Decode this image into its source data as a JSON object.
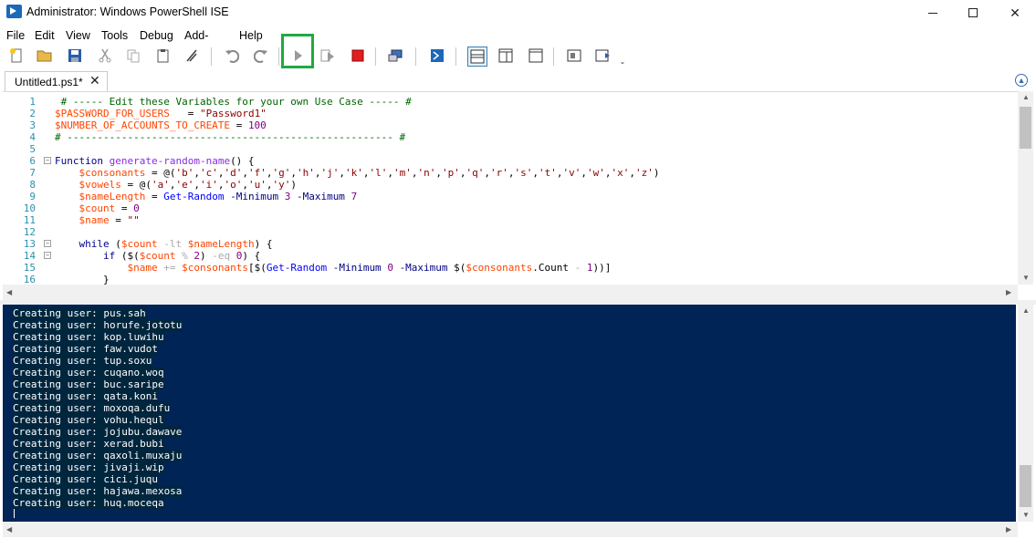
{
  "window": {
    "title": "Administrator: Windows PowerShell ISE"
  },
  "menu": [
    "File",
    "Edit",
    "View",
    "Tools",
    "Debug",
    "Add-ons",
    "Help"
  ],
  "tab": {
    "label": "Untitled1.ps1*",
    "close": "✕"
  },
  "editor": {
    "lines": [
      {
        "n": "1",
        "segs": [
          [
            "c-comment",
            " # ----- Edit these Variables for your own Use Case ----- #"
          ]
        ]
      },
      {
        "n": "2",
        "segs": [
          [
            "c-var",
            "$PASSWORD_FOR_USERS"
          ],
          [
            "c-plain",
            "   = "
          ],
          [
            "c-str",
            "\"Password1\""
          ]
        ]
      },
      {
        "n": "3",
        "segs": [
          [
            "c-var",
            "$NUMBER_OF_ACCOUNTS_TO_CREATE"
          ],
          [
            "c-plain",
            " = "
          ],
          [
            "c-num",
            "100"
          ]
        ]
      },
      {
        "n": "4",
        "segs": [
          [
            "c-comment",
            "# ------------------------------------------------------ #"
          ]
        ]
      },
      {
        "n": "5",
        "segs": []
      },
      {
        "n": "6",
        "fold": true,
        "segs": [
          [
            "c-kw",
            "Function"
          ],
          [
            "c-plain",
            " "
          ],
          [
            "c-fn",
            "generate-random-name"
          ],
          [
            "c-plain",
            "() {"
          ]
        ]
      },
      {
        "n": "7",
        "segs": [
          [
            "c-plain",
            "    "
          ],
          [
            "c-var",
            "$consonants"
          ],
          [
            "c-plain",
            " = @("
          ],
          [
            "c-str",
            "'b'"
          ],
          [
            "c-plain",
            ","
          ],
          [
            "c-str",
            "'c'"
          ],
          [
            "c-plain",
            ","
          ],
          [
            "c-str",
            "'d'"
          ],
          [
            "c-plain",
            ","
          ],
          [
            "c-str",
            "'f'"
          ],
          [
            "c-plain",
            ","
          ],
          [
            "c-str",
            "'g'"
          ],
          [
            "c-plain",
            ","
          ],
          [
            "c-str",
            "'h'"
          ],
          [
            "c-plain",
            ","
          ],
          [
            "c-str",
            "'j'"
          ],
          [
            "c-plain",
            ","
          ],
          [
            "c-str",
            "'k'"
          ],
          [
            "c-plain",
            ","
          ],
          [
            "c-str",
            "'l'"
          ],
          [
            "c-plain",
            ","
          ],
          [
            "c-str",
            "'m'"
          ],
          [
            "c-plain",
            ","
          ],
          [
            "c-str",
            "'n'"
          ],
          [
            "c-plain",
            ","
          ],
          [
            "c-str",
            "'p'"
          ],
          [
            "c-plain",
            ","
          ],
          [
            "c-str",
            "'q'"
          ],
          [
            "c-plain",
            ","
          ],
          [
            "c-str",
            "'r'"
          ],
          [
            "c-plain",
            ","
          ],
          [
            "c-str",
            "'s'"
          ],
          [
            "c-plain",
            ","
          ],
          [
            "c-str",
            "'t'"
          ],
          [
            "c-plain",
            ","
          ],
          [
            "c-str",
            "'v'"
          ],
          [
            "c-plain",
            ","
          ],
          [
            "c-str",
            "'w'"
          ],
          [
            "c-plain",
            ","
          ],
          [
            "c-str",
            "'x'"
          ],
          [
            "c-plain",
            ","
          ],
          [
            "c-str",
            "'z'"
          ],
          [
            "c-plain",
            ")"
          ]
        ]
      },
      {
        "n": "8",
        "segs": [
          [
            "c-plain",
            "    "
          ],
          [
            "c-var",
            "$vowels"
          ],
          [
            "c-plain",
            " = @("
          ],
          [
            "c-str",
            "'a'"
          ],
          [
            "c-plain",
            ","
          ],
          [
            "c-str",
            "'e'"
          ],
          [
            "c-plain",
            ","
          ],
          [
            "c-str",
            "'i'"
          ],
          [
            "c-plain",
            ","
          ],
          [
            "c-str",
            "'o'"
          ],
          [
            "c-plain",
            ","
          ],
          [
            "c-str",
            "'u'"
          ],
          [
            "c-plain",
            ","
          ],
          [
            "c-str",
            "'y'"
          ],
          [
            "c-plain",
            ")"
          ]
        ]
      },
      {
        "n": "9",
        "segs": [
          [
            "c-plain",
            "    "
          ],
          [
            "c-var",
            "$nameLength"
          ],
          [
            "c-plain",
            " = "
          ],
          [
            "c-cmd",
            "Get-Random"
          ],
          [
            "c-plain",
            " "
          ],
          [
            "c-param",
            "-Minimum"
          ],
          [
            "c-plain",
            " "
          ],
          [
            "c-num",
            "3"
          ],
          [
            "c-plain",
            " "
          ],
          [
            "c-param",
            "-Maximum"
          ],
          [
            "c-plain",
            " "
          ],
          [
            "c-num",
            "7"
          ]
        ]
      },
      {
        "n": "10",
        "segs": [
          [
            "c-plain",
            "    "
          ],
          [
            "c-var",
            "$count"
          ],
          [
            "c-plain",
            " = "
          ],
          [
            "c-num",
            "0"
          ]
        ]
      },
      {
        "n": "11",
        "segs": [
          [
            "c-plain",
            "    "
          ],
          [
            "c-var",
            "$name"
          ],
          [
            "c-plain",
            " = "
          ],
          [
            "c-str",
            "\"\""
          ]
        ]
      },
      {
        "n": "12",
        "segs": []
      },
      {
        "n": "13",
        "fold": true,
        "segs": [
          [
            "c-plain",
            "    "
          ],
          [
            "c-kw",
            "while"
          ],
          [
            "c-plain",
            " ("
          ],
          [
            "c-var",
            "$count"
          ],
          [
            "c-plain",
            " "
          ],
          [
            "c-op",
            "-lt"
          ],
          [
            "c-plain",
            " "
          ],
          [
            "c-var",
            "$nameLength"
          ],
          [
            "c-plain",
            ") {"
          ]
        ]
      },
      {
        "n": "14",
        "fold": true,
        "segs": [
          [
            "c-plain",
            "        "
          ],
          [
            "c-kw",
            "if"
          ],
          [
            "c-plain",
            " ($("
          ],
          [
            "c-var",
            "$count"
          ],
          [
            "c-plain",
            " "
          ],
          [
            "c-op",
            "%"
          ],
          [
            "c-plain",
            " "
          ],
          [
            "c-num",
            "2"
          ],
          [
            "c-plain",
            ") "
          ],
          [
            "c-op",
            "-eq"
          ],
          [
            "c-plain",
            " "
          ],
          [
            "c-num",
            "0"
          ],
          [
            "c-plain",
            ") {"
          ]
        ]
      },
      {
        "n": "15",
        "segs": [
          [
            "c-plain",
            "            "
          ],
          [
            "c-var",
            "$name"
          ],
          [
            "c-plain",
            " "
          ],
          [
            "c-op",
            "+="
          ],
          [
            "c-plain",
            " "
          ],
          [
            "c-var",
            "$consonants"
          ],
          [
            "c-plain",
            "[$("
          ],
          [
            "c-cmd",
            "Get-Random"
          ],
          [
            "c-plain",
            " "
          ],
          [
            "c-param",
            "-Minimum"
          ],
          [
            "c-plain",
            " "
          ],
          [
            "c-num",
            "0"
          ],
          [
            "c-plain",
            " "
          ],
          [
            "c-param",
            "-Maximum"
          ],
          [
            "c-plain",
            " $("
          ],
          [
            "c-var",
            "$consonants"
          ],
          [
            "c-plain",
            "."
          ],
          [
            "c-plain",
            "Count"
          ],
          [
            "c-plain",
            " "
          ],
          [
            "c-op",
            "-"
          ],
          [
            "c-plain",
            " "
          ],
          [
            "c-num",
            "1"
          ],
          [
            "c-plain",
            "))]"
          ]
        ]
      },
      {
        "n": "16",
        "segs": [
          [
            "c-plain",
            "        }"
          ]
        ]
      }
    ]
  },
  "console": {
    "lines": [
      "Creating user: pus.sah",
      "Creating user: horufe.jototu",
      "Creating user: kop.luwihu",
      "Creating user: faw.vudot",
      "Creating user: tup.soxu",
      "Creating user: cuqano.woq",
      "Creating user: buc.saripe",
      "Creating user: qata.koni",
      "Creating user: moxoqa.dufu",
      "Creating user: vohu.hequl",
      "Creating user: jojubu.dawave",
      "Creating user: xerad.bubi",
      "Creating user: qaxoli.muxaju",
      "Creating user: jivaji.wip",
      "Creating user: cici.juqu",
      "Creating user: hajawa.mexosa",
      "Creating user: huq.moceqa"
    ]
  },
  "toolbar": {
    "icons": [
      "new-icon",
      "open-icon",
      "save-icon",
      "cut-icon",
      "copy-icon",
      "paste-icon",
      "clear-icon",
      "undo-icon",
      "redo-icon",
      "run-script-icon",
      "run-selection-icon",
      "stop-icon",
      "remote-tab-icon",
      "powershell-console-icon",
      "show-script-top-icon",
      "show-script-right-icon",
      "show-script-max-icon",
      "show-command-window-icon",
      "show-command-addon-icon",
      "overflow-icon"
    ]
  },
  "colors": {
    "console_bg": "#012456",
    "highlight_border": "#21a842",
    "stop_red": "#e02020"
  }
}
